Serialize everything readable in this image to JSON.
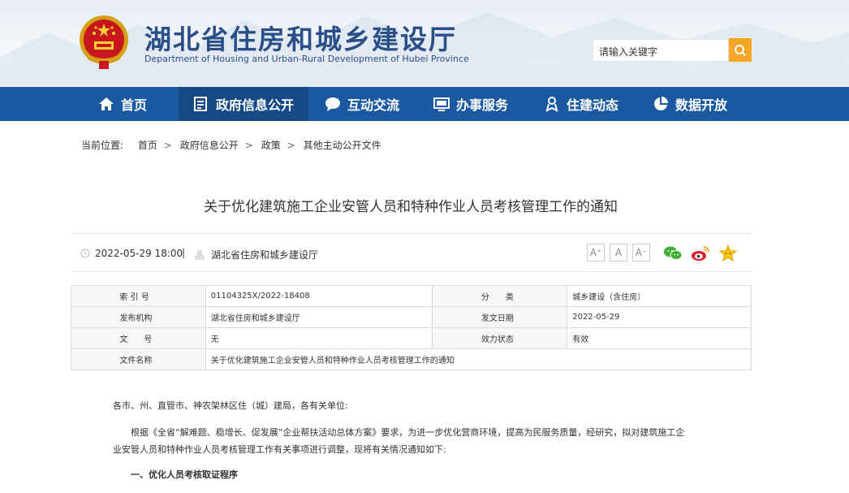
{
  "header": {
    "title": "湖北省住房和城乡建设厅",
    "subtitle": "Department of Housing and Urban-Rural Development of Hubei Province",
    "search_placeholder": "请输入关键字"
  },
  "nav": [
    {
      "label": "首页",
      "icon": "home-icon"
    },
    {
      "label": "政府信息公开",
      "icon": "document-icon"
    },
    {
      "label": "互动交流",
      "icon": "chat-bubble-icon"
    },
    {
      "label": "办事服务",
      "icon": "monitor-icon"
    },
    {
      "label": "住建动态",
      "icon": "person-badge-icon"
    },
    {
      "label": "数据开放",
      "icon": "pie-chart-icon"
    }
  ],
  "breadcrumb": {
    "prefix": "当前位置:",
    "items": [
      "首页",
      "政府信息公开",
      "政策",
      "其他主动公开文件"
    ],
    "separator": ">"
  },
  "article": {
    "title": "关于优化建筑施工企业安管人员和特种作业人员考核管理工作的通知",
    "date": "2022-05-29 18:00",
    "divider": "|",
    "source": "湖北省住房和城乡建设厅",
    "font_sizes": [
      "A⁺",
      "A",
      "A⁻"
    ]
  },
  "info_table": {
    "index_label": "索 引 号",
    "index_value": "01104325X/2022-18408",
    "category_label": "分　　类",
    "category_value": "城乡建设（含住房）",
    "issuer_label": "发布机构",
    "issuer_value": "湖北省住房和城乡建设厅",
    "date_label": "发文日期",
    "date_value": "2022-05-29",
    "docno_label": "文　　号",
    "docno_value": "无",
    "status_label": "效力状态",
    "status_value": "有效",
    "name_label": "文件名称",
    "name_value": "关于优化建筑施工企业安管人员和特种作业人员考核管理工作的通知"
  },
  "body": {
    "salutation": "各市、州、直管市、神农架林区住（城）建局，各有关单位:",
    "para1_line1": "根据《全省“解难题、稳增长、促发展”企业帮扶活动总体方案》要求，为进一步优化营商环境，提高为民服务质量，经研究，拟对建筑施工企",
    "para1_line2": "业安管人员和特种作业人员考核管理工作有关事项进行调整，现将有关情况通知如下:",
    "section1": "一、优化人员考核取证程序"
  },
  "colors": {
    "nav_bg": "#1b5aa0",
    "nav_active": "#154a86",
    "title_blue": "#2a4e86",
    "search_btn": "#f5a623"
  }
}
